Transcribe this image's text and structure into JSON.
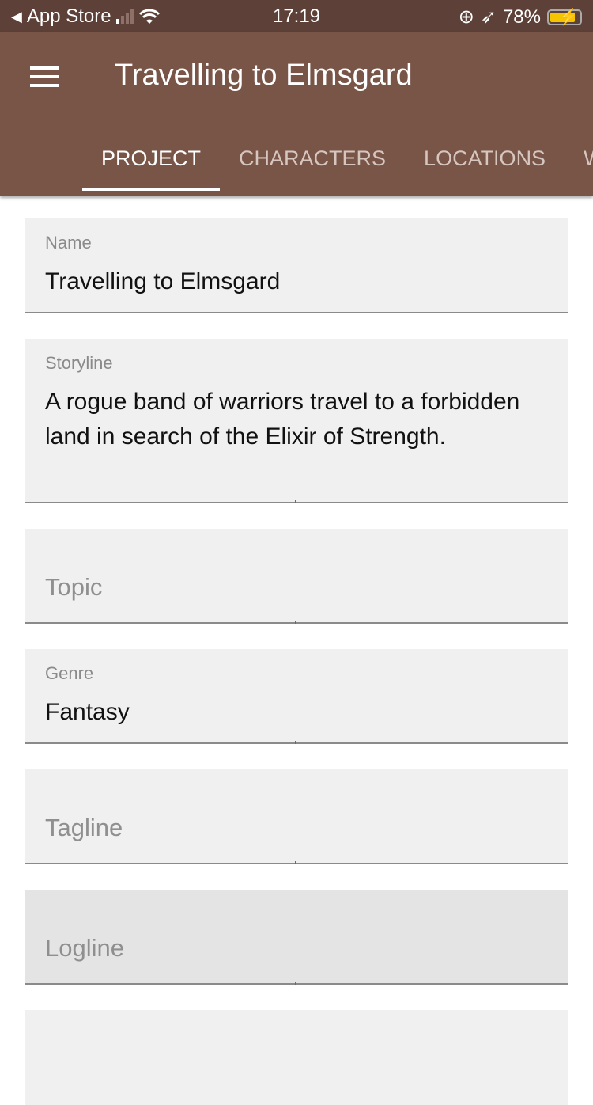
{
  "status_bar": {
    "back_label": "App Store",
    "time": "17:19",
    "battery": "78%",
    "battery_level": 78,
    "charging": true,
    "icons": [
      "back-arrow-icon",
      "signal-icon",
      "wifi-icon",
      "orientation-lock-icon",
      "location-icon",
      "battery-icon"
    ]
  },
  "app_bar": {
    "title": "Travelling to Elmsgard",
    "menu_icon": "hamburger-menu-icon",
    "color": "#795548"
  },
  "tabs": [
    {
      "label": "PROJECT",
      "active": true
    },
    {
      "label": "CHARACTERS"
    },
    {
      "label": "LOCATIONS"
    },
    {
      "label": "W"
    }
  ],
  "fields": [
    {
      "label": "Name",
      "value": "Travelling to Elmsgard"
    },
    {
      "label": "Storyline",
      "value": "A rogue band of warriors travel to a forbidden land in search of the Elixir of Strength."
    },
    {
      "placeholder": "Topic"
    },
    {
      "label": "Genre",
      "value": "Fantasy"
    },
    {
      "placeholder": "Tagline"
    },
    {
      "placeholder": "Logline"
    }
  ]
}
